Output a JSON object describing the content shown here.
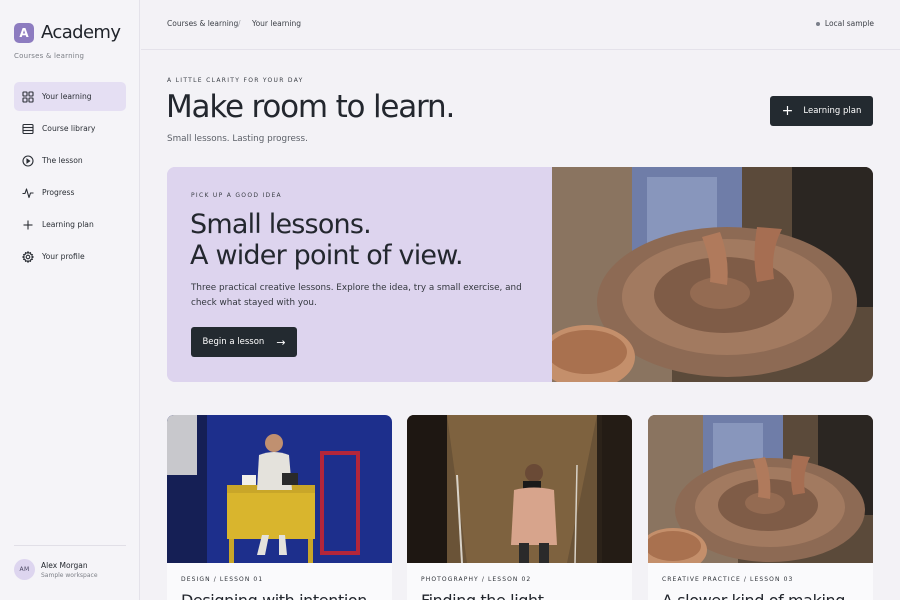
{
  "app": {
    "brand_initial": "A",
    "brand_name": "Academy",
    "brand_subtitle": "Courses & learning"
  },
  "sidebar": {
    "items": [
      {
        "label": "Your learning",
        "icon": "grid-icon",
        "active": true
      },
      {
        "label": "Course library",
        "icon": "library-icon",
        "active": false
      },
      {
        "label": "The lesson",
        "icon": "play-circle-icon",
        "active": false
      },
      {
        "label": "Progress",
        "icon": "activity-icon",
        "active": false
      },
      {
        "label": "Learning plan",
        "icon": "plus-icon",
        "active": false
      },
      {
        "label": "Your profile",
        "icon": "gear-icon",
        "active": false
      }
    ]
  },
  "user": {
    "initials": "AM",
    "name": "Alex Morgan",
    "workspace": "Sample workspace"
  },
  "topbar": {
    "breadcrumb": [
      "Courses & learning",
      "Your learning"
    ],
    "separator": "/",
    "status": "Local sample"
  },
  "header": {
    "kicker": "A LITTLE CLARITY FOR YOUR DAY",
    "title": "Make room to learn.",
    "subtitle": "Small lessons. Lasting progress.",
    "plan_button": "Learning plan"
  },
  "hero": {
    "kicker": "PICK UP A GOOD IDEA",
    "title_line1": "Small lessons.",
    "title_line2": "A wider point of view.",
    "description": "Three practical creative lessons. Explore the idea, try a small exercise, and check what stayed with you.",
    "button": "Begin a lesson"
  },
  "cards": [
    {
      "meta": "DESIGN / LESSON 01",
      "title": "Designing with intention"
    },
    {
      "meta": "PHOTOGRAPHY / LESSON 02",
      "title": "Finding the light"
    },
    {
      "meta": "CREATIVE PRACTICE / LESSON 03",
      "title": "A slower kind of making"
    }
  ],
  "colors": {
    "accent": "#8d7cc0",
    "hero_bg": "#ddd4ee",
    "active_nav": "#e5dff3",
    "button_dark": "#232a30"
  }
}
